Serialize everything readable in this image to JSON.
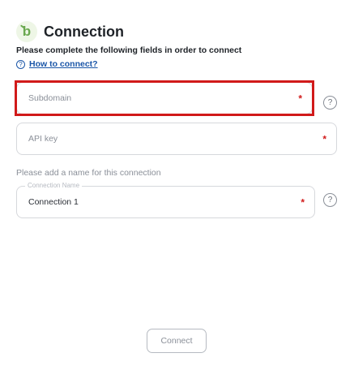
{
  "header": {
    "title": "Connection",
    "subtitle": "Please complete the following fields in order to connect",
    "help_link": "How to connect?",
    "help_glyph": "?"
  },
  "fields": {
    "subdomain": {
      "placeholder": "Subdomain",
      "required_mark": "*",
      "help_glyph": "?"
    },
    "api_key": {
      "placeholder": "API key",
      "required_mark": "*"
    },
    "connection_name": {
      "legend": "Connection Name",
      "value": "Connection 1",
      "required_mark": "*",
      "help_glyph": "?"
    }
  },
  "section": {
    "name_prompt": "Please add a name for this connection"
  },
  "actions": {
    "connect_label": "Connect"
  },
  "colors": {
    "brand": "#6aa84f",
    "link": "#1a56a8",
    "required": "#d11a1a",
    "highlight": "#d11a1a"
  },
  "icons": {
    "logo": "brand-logo-icon",
    "help": "question-circle-icon"
  }
}
